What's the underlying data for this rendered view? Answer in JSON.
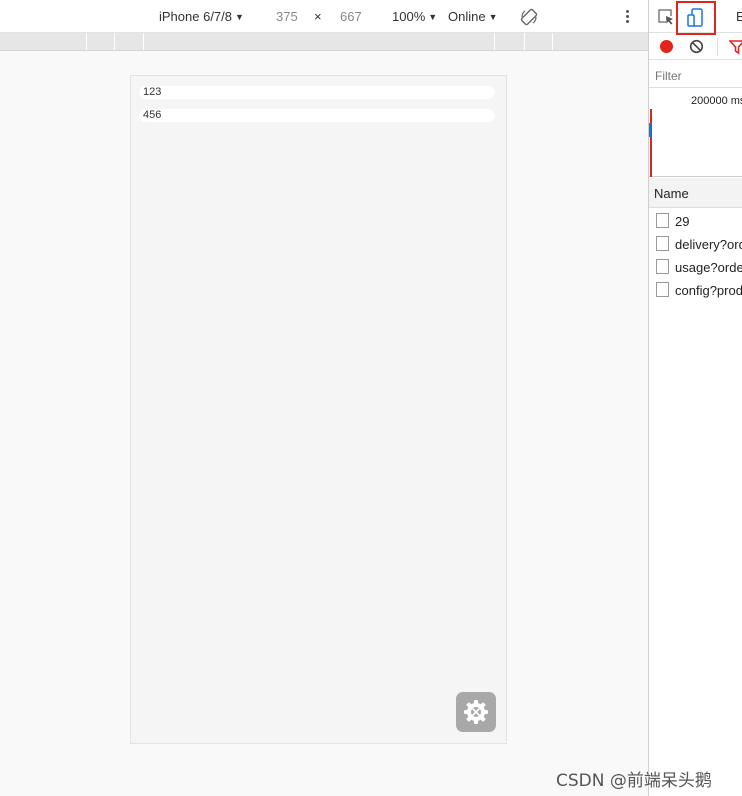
{
  "device_toolbar": {
    "device_name": "iPhone 6/7/8",
    "width": "375",
    "times": "×",
    "height": "667",
    "zoom": "100%",
    "throttle": "Online",
    "caret": "▼",
    "rotate_icon": "rotate-icon",
    "more_icon": "kebab-menu-icon"
  },
  "phone_screen": {
    "rows": [
      "123",
      "456"
    ],
    "fab_icon": "settings-gear-icon",
    "background_color": "#f5f5f5"
  },
  "devtools": {
    "inspect_icon": "inspect-element-icon",
    "device_toggle_icon": "device-toolbar-icon",
    "device_toggle_highlight": "#e0251b",
    "partial_tab_label": "E",
    "network": {
      "record_color": "#e0251b",
      "filter_placeholder": "Filter",
      "overview_label": "200000 ms",
      "name_column": "Name",
      "requests": [
        "29",
        "delivery?order",
        "usage?order",
        "config?prod"
      ]
    }
  },
  "watermark": "CSDN @前端呆头鹅"
}
